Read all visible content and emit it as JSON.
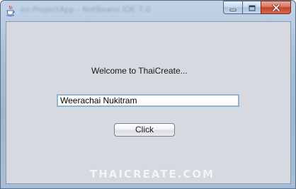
{
  "window": {
    "title": "ex-ProjectApp - NetBeans IDE 7.0"
  },
  "icons": {
    "app": "java-cup-icon",
    "minimize": "minimize-icon",
    "maximize": "maximize-icon",
    "close": "close-icon"
  },
  "form": {
    "welcome_label": "Welcome to ThaiCreate...",
    "name_value": "Weerachai Nukitram",
    "click_label": "Click"
  },
  "watermark": {
    "text": "THAICREATE.COM"
  },
  "colors": {
    "content_background": "#d6d9df",
    "close_button": "#c4452a",
    "input_border": "#8fb4d6"
  }
}
